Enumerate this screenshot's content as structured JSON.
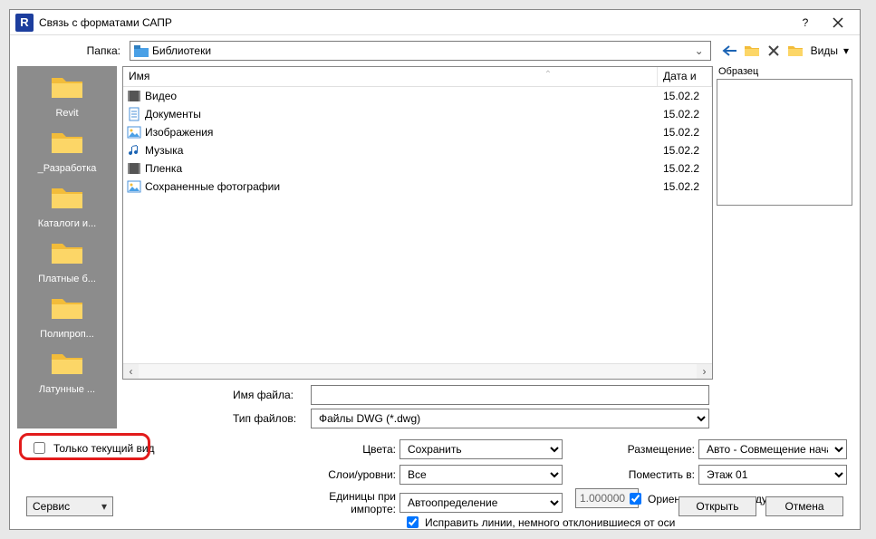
{
  "title": "Связь с форматами САПР",
  "folder_label": "Папка:",
  "folder_value": "Библиотеки",
  "views_label": "Виды",
  "preview_label": "Образец",
  "columns": {
    "name": "Имя",
    "date": "Дата и"
  },
  "sidebar": [
    {
      "label": "Revit"
    },
    {
      "label": "_Разработка"
    },
    {
      "label": "Каталоги и..."
    },
    {
      "label": "Платные б..."
    },
    {
      "label": "Полипроп..."
    },
    {
      "label": "Латунные ..."
    }
  ],
  "files": [
    {
      "name": "Видео",
      "date": "15.02.2",
      "icon": "film"
    },
    {
      "name": "Документы",
      "date": "15.02.2",
      "icon": "doc"
    },
    {
      "name": "Изображения",
      "date": "15.02.2",
      "icon": "img"
    },
    {
      "name": "Музыка",
      "date": "15.02.2",
      "icon": "music"
    },
    {
      "name": "Пленка",
      "date": "15.02.2",
      "icon": "film"
    },
    {
      "name": "Сохраненные фотографии",
      "date": "15.02.2",
      "icon": "img"
    }
  ],
  "filename_label": "Имя файла:",
  "filetype_label": "Тип файлов:",
  "filetype_value": "Файлы DWG  (*.dwg)",
  "current_view_label": "Только текущий вид",
  "opts": {
    "colors_label": "Цвета:",
    "colors_value": "Сохранить",
    "layers_label": "Слои/уровни:",
    "layers_value": "Все",
    "units_label": "Единицы при импорте:",
    "units_value": "Автоопределение",
    "units_factor": "1.000000",
    "placement_label": "Размещение:",
    "placement_value": "Авто - Совмещение начал координа",
    "placeat_label": "Поместить в:",
    "placeat_value": "Этаж 01",
    "orient_label": "Ориентировать по виду",
    "fixlines_label": "Исправить линии, немного отклонившиеся от оси"
  },
  "service_label": "Сервис",
  "open_label": "Открыть",
  "cancel_label": "Отмена"
}
